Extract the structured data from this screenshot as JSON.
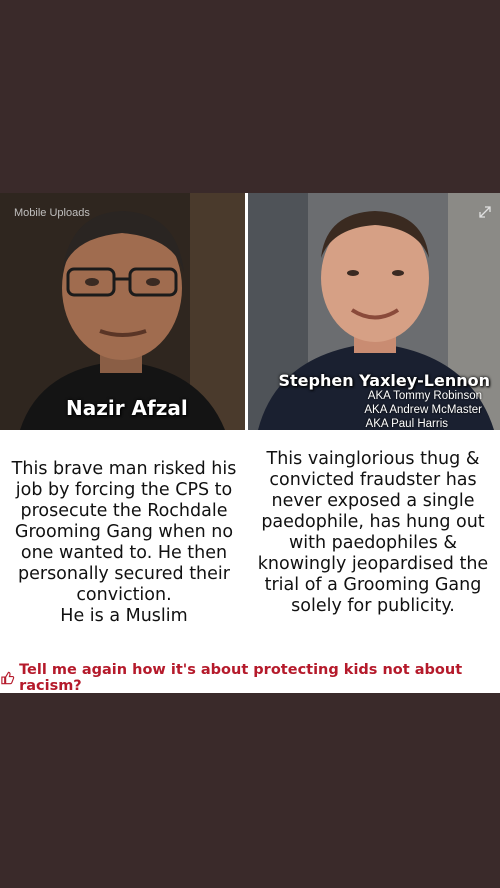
{
  "watermark": "Mobile Uploads",
  "left": {
    "name": "Nazir Afzal",
    "text_lines": [
      "This brave man risked his",
      "job by forcing the CPS to",
      "prosecute the Rochdale",
      "Grooming Gang when no",
      "one wanted to. He then",
      "personally secured their",
      "conviction.",
      "He is a Muslim"
    ]
  },
  "right": {
    "name": "Stephen Yaxley-Lennon",
    "aka": [
      "AKA Tommy Robinson",
      "AKA Andrew McMaster",
      "AKA Paul Harris"
    ],
    "text_lines": [
      "This vainglorious thug &",
      "convicted fraudster has",
      "never exposed a single",
      "paedophile, has hung out",
      "with paedophiles &",
      "knowingly jeopardised the",
      "trial of a Grooming Gang",
      "solely for publicity."
    ]
  },
  "footer": "Tell me again how it's about protecting kids not about racism?",
  "icons": [
    "expand-icon",
    "thumbs-up-icon"
  ],
  "colors": {
    "background": "#3a2a2a",
    "accent": "#b51a2b"
  }
}
